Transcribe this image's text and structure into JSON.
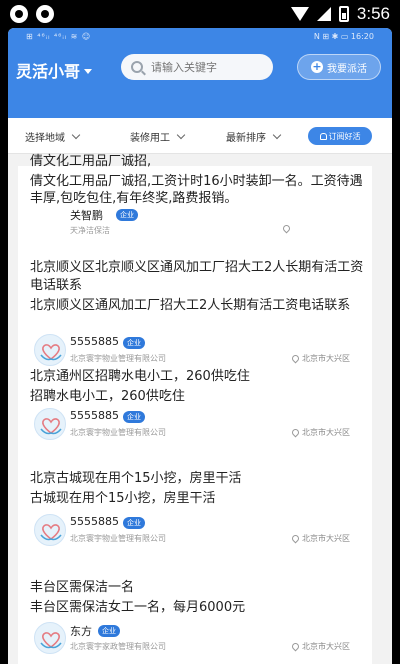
{
  "device": {
    "time": "3:56"
  },
  "inner_status": {
    "left": "⊞ ⁴⁶ᵢₗ ⁴⁶ᵢₗ ≋ ☺",
    "right": "N ⊞ ✱ ▭ 16:20"
  },
  "header": {
    "brand": "灵活小哥",
    "search_placeholder": "请输入关键字",
    "dispatch_label": "我要派活",
    "colors": {
      "primary": "#3d86e6",
      "badge": "#2f79db"
    }
  },
  "filters": {
    "items": [
      "选择地域",
      "装修用工",
      "最新排序"
    ],
    "subscribe_label": "订阅好活"
  },
  "posts": [
    {
      "title": "倩文化工用品厂诚招,",
      "desc": "倩文化工用品厂诚招,工资计时16小时装卸一名。工资待遇丰厚,包吃包住,有年终奖,路费报销。",
      "name": "关智鹏",
      "badge": "企业",
      "company": "天净洁保洁",
      "location": ""
    },
    {
      "title": "北京顺义区北京顺义区通风加工厂招大工2人长期有活工资电话联系",
      "desc": "北京顺义区通风加工厂招大工2人长期有活工资电话联系",
      "name": "5555885",
      "badge": "企业",
      "company": "北京寰宇物业管理有限公司",
      "location": "北京市大兴区"
    },
    {
      "title": "北京通州区招聘水电小工，260供吃住",
      "desc": "招聘水电小工，260供吃住",
      "name": "5555885",
      "badge": "企业",
      "company": "北京寰宇物业管理有限公司",
      "location": "北京市大兴区"
    },
    {
      "title": "北京古城现在用个15小挖，房里干活",
      "desc": "古城现在用个15小挖，房里干活",
      "name": "5555885",
      "badge": "企业",
      "company": "北京寰宇物业管理有限公司",
      "location": "北京市大兴区"
    },
    {
      "title": "丰台区需保洁一名",
      "desc": "丰台区需保洁女工一名，每月6000元",
      "name": "东方",
      "badge": "企业",
      "company": "北京寰宇家政管理有限公司",
      "location": "北京市大兴区"
    }
  ]
}
